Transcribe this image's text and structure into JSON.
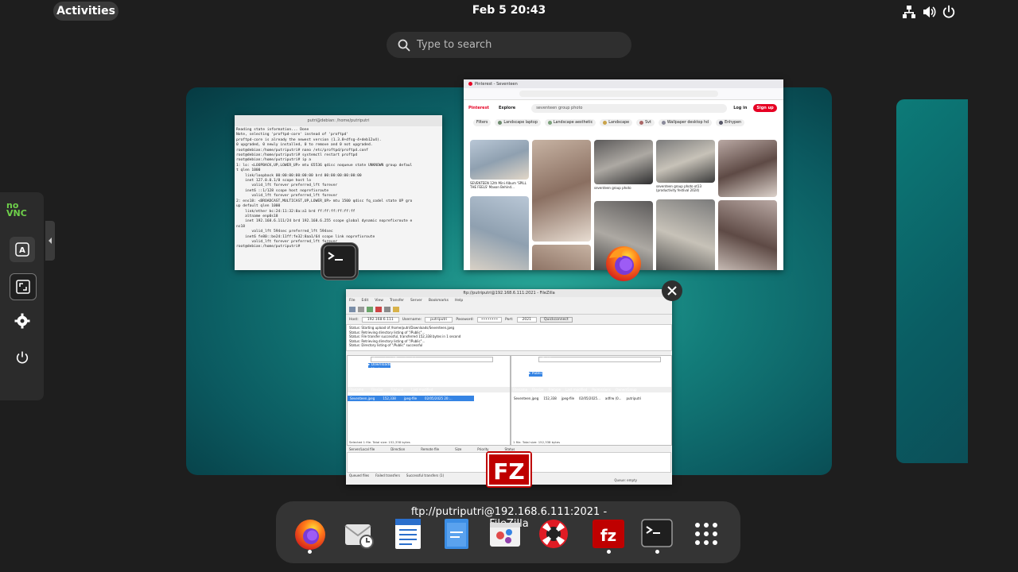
{
  "topbar": {
    "activities_label": "Activities",
    "clock": "Feb 5  20:43",
    "tray_icons": [
      "network-icon",
      "volume-icon",
      "power-icon"
    ]
  },
  "search": {
    "placeholder": "Type to search"
  },
  "windows": {
    "terminal": {
      "title": "putri@debian: /home/putriputri",
      "lines": [
        "Reading state information... Done",
        "Note, selecting 'proftpd-core' instead of 'proftpd'",
        "proftpd-core is already the newest version (1.3.8+dfsg-4+deb12u4).",
        "0 upgraded, 0 newly installed, 0 to remove and 0 not upgraded.",
        "root@debian:/home/putriputri# nano /etc/proftpd/proftpd.conf",
        "root@debian:/home/putriputri# systemctl restart proftpd",
        "root@debian:/home/putriputri# ip a",
        "1: lo: <LOOPBACK,UP,LOWER_UP> mtu 65536 qdisc noqueue state UNKNOWN group defaul",
        "t qlen 1000",
        "    link/loopback 00:00:00:00:00:00 brd 00:00:00:00:00:00",
        "    inet 127.0.0.1/8 scope host lo",
        "       valid_lft forever preferred_lft forever",
        "    inet6 ::1/128 scope host noprefixroute",
        "       valid_lft forever preferred_lft forever",
        "2: ens18: <BROADCAST,MULTICAST,UP,LOWER_UP> mtu 1500 qdisc fq_codel state UP gro",
        "up default qlen 1000",
        "    link/ether bc:24:11:32:8a:a1 brd ff:ff:ff:ff:ff:ff",
        "    altname enp0s18",
        "    inet 192.168.6.111/24 brd 192.168.6.255 scope global dynamic noprefixroute e",
        "ns18",
        "       valid_lft 594sec preferred_lft 594sec",
        "    inet6 fe80::be24:11ff:fe32:8aa1/64 scope link noprefixroute",
        "       valid_lft forever preferred_lft forever",
        "root@debian:/home/putriputri# "
      ]
    },
    "firefox": {
      "tab_title": "Pinterest - Seventeen",
      "search_text": "seventeen group photo",
      "login_label": "Log in",
      "signup_label": "Sign up",
      "nav_explore": "Explore",
      "filter_label": "Filters",
      "chips": [
        "Landscape laptop",
        "Landscape aesthetic",
        "Landscape",
        "Svt",
        "Wallpaper desktop hd",
        "Enhypen"
      ],
      "pins": [
        {
          "caption": "SEVENTEEN 12th Mini Album 'SPILL THE FEELS' Maxon Behind...",
          "colors": [
            "#b9c7d6",
            "#8fa0b0",
            "#e2d7c8"
          ]
        },
        {
          "caption": "",
          "colors": [
            "#c7b3a3",
            "#8a6f61",
            "#e8ddd2"
          ]
        },
        {
          "caption": "seventeen group photo",
          "colors": [
            "#5c5a5a",
            "#ada9a3",
            "#2f2f30"
          ]
        },
        {
          "caption": "seventeen group photo ot13 (productivity festival 2024)",
          "colors": [
            "#7b7b7b",
            "#c7c2b8",
            "#3a3a3a"
          ]
        },
        {
          "caption": "",
          "colors": [
            "#b9a8a3",
            "#5e4a45",
            "#ddd3cc"
          ]
        }
      ]
    },
    "filezilla": {
      "title": "ftp://putriputri@192.168.6.111:2021 - FileZilla",
      "menu": [
        "File",
        "Edit",
        "View",
        "Transfer",
        "Server",
        "Bookmarks",
        "Help"
      ],
      "host_label": "Host:",
      "host_value": "192.168.6.111",
      "user_label": "Username:",
      "user_value": "putriputri",
      "pass_label": "Password:",
      "pass_value": "••••••••",
      "port_label": "Port:",
      "port_value": "2021",
      "quickconnect_label": "Quickconnect",
      "log": [
        "Status:   Starting upload of /home/putri/Downloads/Seventeen.jpeg",
        "Status:   Retrieving directory listing of \"/Public\"...",
        "Status:   File transfer successful, transferred 152,338 bytes in 1 second",
        "Status:   Retrieving directory listing of \"/Public\"...",
        "Status:   Directory listing of \"/Public\" successful"
      ],
      "local_site_label": "Local site:",
      "local_site_path": "/home/putri/Downloads/",
      "remote_site_label": "Remote site:",
      "remote_site_path": "/Public",
      "local_tree": [
        "Downloads",
        "Music",
        "Pictures"
      ],
      "remote_tree": [
        "Music",
        "Pictures",
        "Public"
      ],
      "local_headers": [
        "Filename",
        "Filesize",
        "Filetype",
        "Last modified"
      ],
      "remote_headers": [
        "Filename",
        "Filesize",
        "Filetype",
        "Last modified",
        "Permissions",
        "Owner/Group"
      ],
      "local_file": {
        "name": "Seventeen.jpeg",
        "size": "152,338",
        "type": "jpeg-file",
        "modified": "02/05/2025 20:..."
      },
      "remote_file": {
        "name": "Seventeen.jpeg",
        "size": "152,338",
        "type": "jpeg-file",
        "modified": "02/05/2025...",
        "perms": "adfrw (0...",
        "owner": "putriputri"
      },
      "local_status": "Selected 1 file. Total size: 152,338 bytes",
      "remote_status": "1 file. Total size: 152,338 bytes",
      "queue_headers": [
        "Server/Local file",
        "Direction",
        "Remote file",
        "Size",
        "Priority",
        "Status"
      ],
      "queue_tabs": [
        "Queued files",
        "Failed transfers",
        "Successful transfers (1)"
      ],
      "queue_status": "Queue: empty"
    }
  },
  "vnc_panel": {
    "logo_text": "no\nVNC",
    "buttons": [
      "keyboard-a-icon",
      "fullscreen-icon",
      "settings-icon",
      "power-icon"
    ]
  },
  "dash": {
    "tooltip": "ftp://putriputri@192.168.6.111:2021 - FileZilla",
    "apps": [
      {
        "name": "firefox",
        "running": true
      },
      {
        "name": "evolution-mail",
        "running": false
      },
      {
        "name": "libreoffice-writer",
        "running": false
      },
      {
        "name": "text-editor",
        "running": false
      },
      {
        "name": "gnome-software",
        "running": false
      },
      {
        "name": "help",
        "running": false
      },
      {
        "name": "filezilla",
        "running": true
      },
      {
        "name": "terminal",
        "running": true
      },
      {
        "name": "app-grid",
        "running": false
      }
    ]
  },
  "colors": {
    "accent_blue": "#3584e4",
    "filezilla_red": "#bf0000",
    "pinterest_red": "#e60023",
    "workspace_teal": "#137d7a"
  }
}
